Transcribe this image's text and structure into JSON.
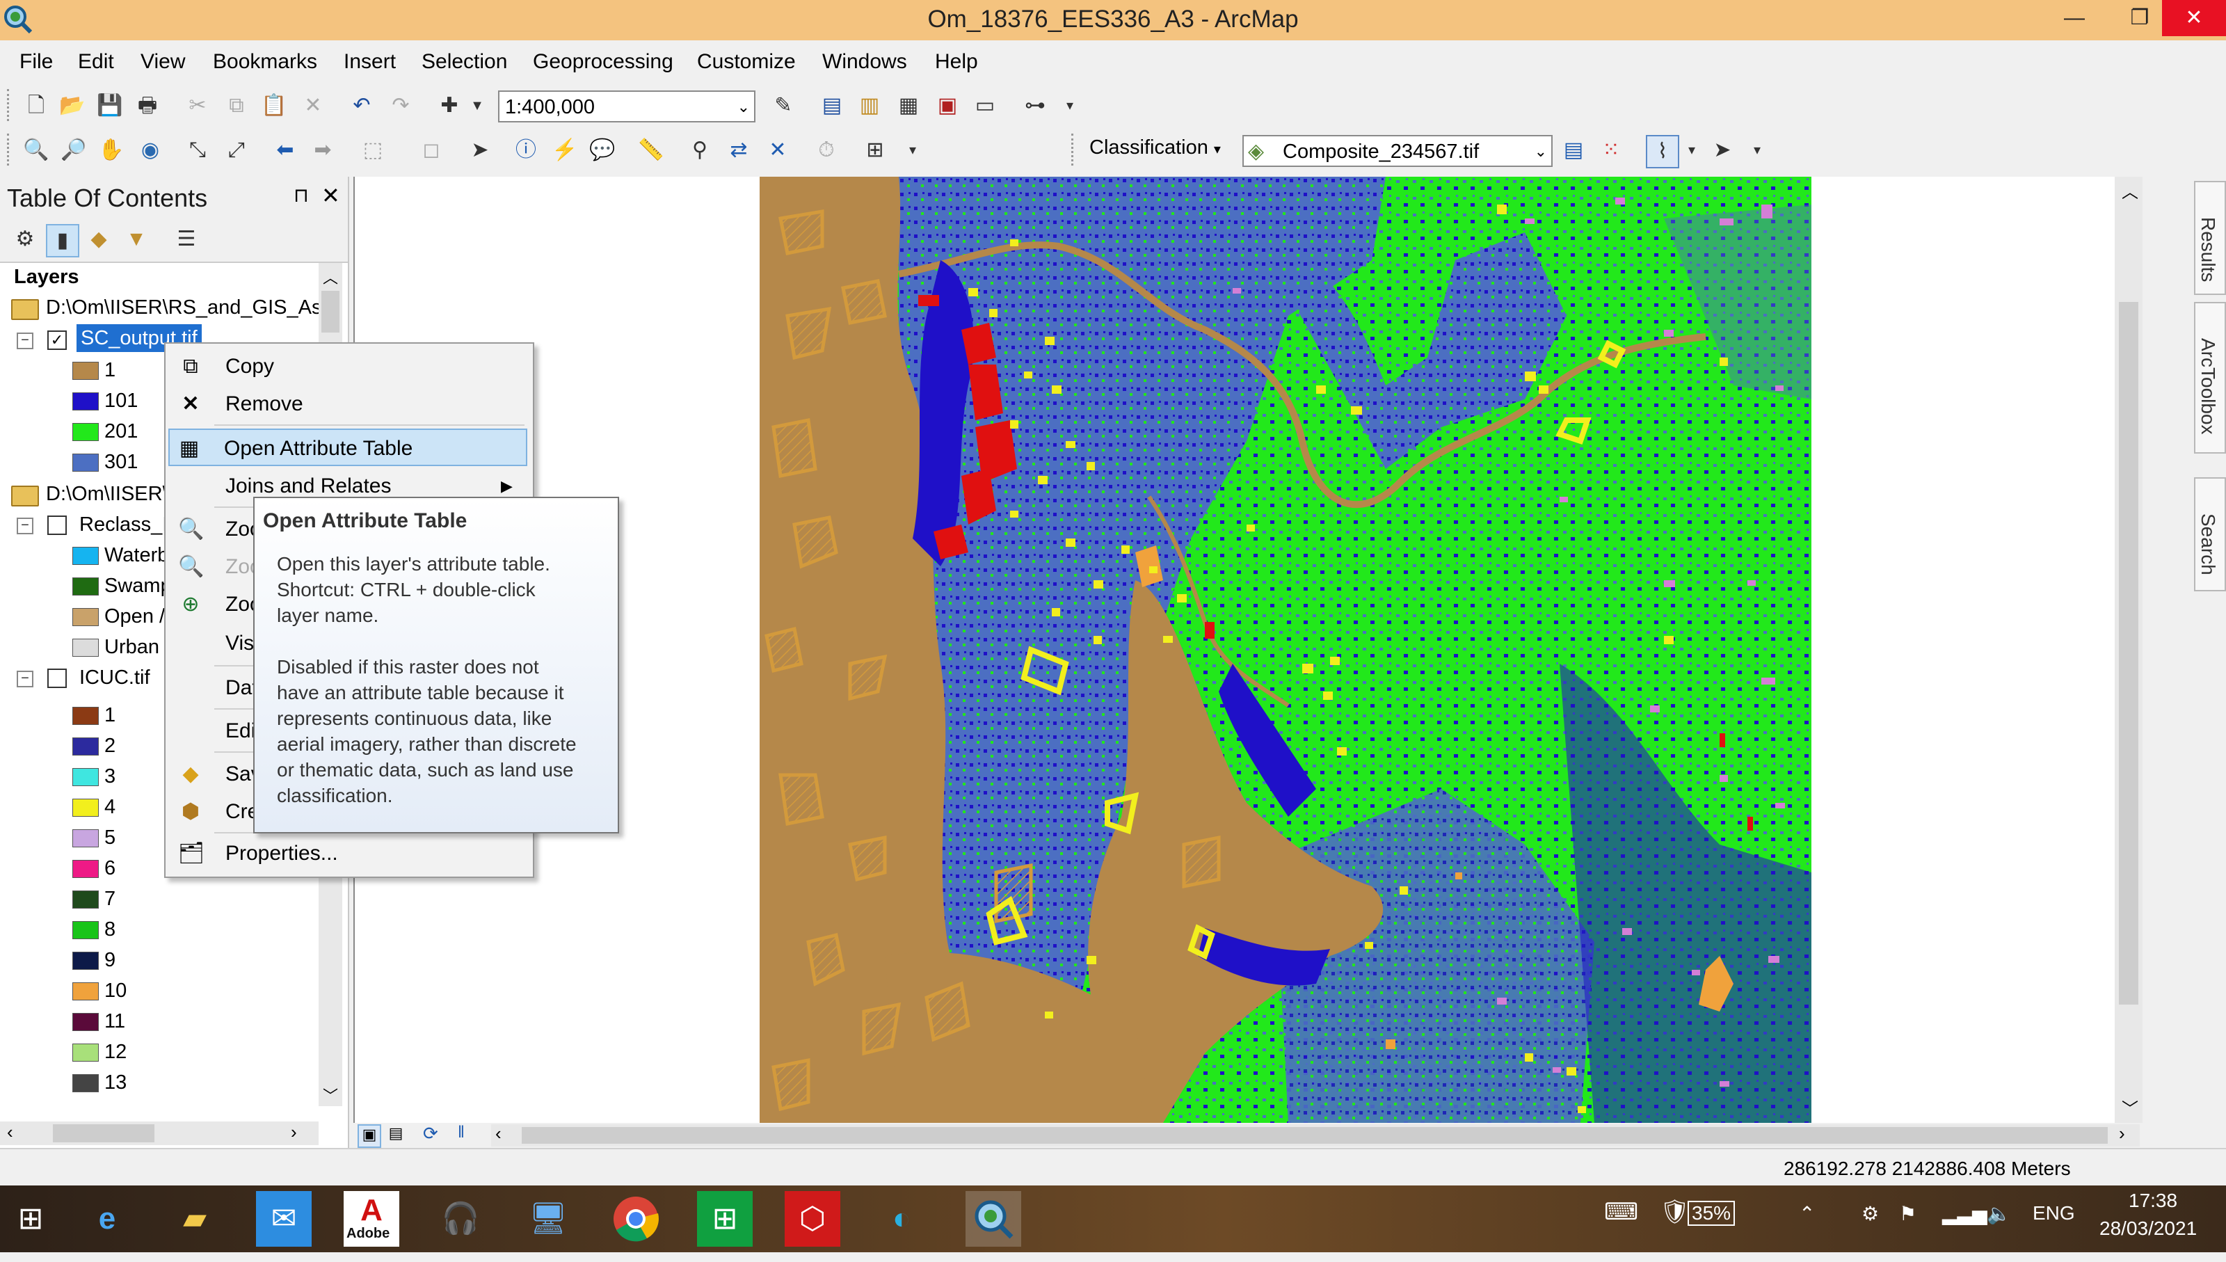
{
  "window": {
    "title": "Om_18376_EES336_A3 - ArcMap",
    "minimize": "—",
    "maximize": "❐",
    "close": "✕"
  },
  "menu": [
    "File",
    "Edit",
    "View",
    "Bookmarks",
    "Insert",
    "Selection",
    "Geoprocessing",
    "Customize",
    "Windows",
    "Help"
  ],
  "toolbar": {
    "scale": "1:400,000",
    "classification_label": "Classification",
    "layer_combo": "Composite_234567.tif"
  },
  "toc": {
    "title": "Table Of Contents",
    "pin": "⊓",
    "close": "✕",
    "root": "Layers",
    "folder1": "D:\\Om\\IISER\\RS_and_GIS_Ass",
    "layer1": {
      "name": "SC_output.tif",
      "legend": [
        {
          "label": "1",
          "color": "#b5884a"
        },
        {
          "label": "101",
          "color": "#1f10c8"
        },
        {
          "label": "201",
          "color": "#22e81b"
        },
        {
          "label": "301",
          "color": "#4c6fc2"
        }
      ]
    },
    "folder2": "D:\\Om\\IISER\\",
    "layer2": {
      "name": "Reclass_I",
      "legend": [
        {
          "label": "Waterb",
          "color": "#15b4f0"
        },
        {
          "label": "Swamp",
          "color": "#1f6b12"
        },
        {
          "label": "Open /",
          "color": "#c9a26a"
        },
        {
          "label": "Urban",
          "color": "#dcdcdc"
        }
      ]
    },
    "layer3": {
      "name": "ICUC.tif",
      "legend": [
        {
          "label": "1",
          "color": "#8b3a14"
        },
        {
          "label": "2",
          "color": "#2c2a9e"
        },
        {
          "label": "3",
          "color": "#3fe6e0"
        },
        {
          "label": "4",
          "color": "#f2ef1d"
        },
        {
          "label": "5",
          "color": "#c8a6e0"
        },
        {
          "label": "6",
          "color": "#ee1a86"
        },
        {
          "label": "7",
          "color": "#1f4a1c"
        },
        {
          "label": "8",
          "color": "#19c419"
        },
        {
          "label": "9",
          "color": "#0d1a48"
        },
        {
          "label": "10",
          "color": "#f0a23c"
        },
        {
          "label": "11",
          "color": "#5a0a3a"
        },
        {
          "label": "12",
          "color": "#a8e07a"
        },
        {
          "label": "13",
          "color": "#444444"
        }
      ]
    }
  },
  "context_menu": {
    "items": [
      "Copy",
      "Remove",
      "Open Attribute Table",
      "Joins and Relates",
      "Zoo",
      "Zoo",
      "Zoo",
      "Visi",
      "Dat",
      "Edi",
      "Sav",
      "Cre",
      "Properties..."
    ]
  },
  "tooltip": {
    "title": "Open Attribute Table",
    "line1": "Open this layer's attribute table.",
    "line2": "Shortcut: CTRL + double-click",
    "line3": "layer name.",
    "line4": "Disabled if this raster does not",
    "line5": "have an attribute table because it",
    "line6": "represents continuous data, like",
    "line7": "aerial imagery, rather than discrete",
    "line8": "or thematic data, such as land use",
    "line9": "classification."
  },
  "right_dock": [
    "Results",
    "ArcToolbox",
    "Search"
  ],
  "status": {
    "coords": "286192.278  2142886.408 Meters"
  },
  "taskbar": {
    "battery": "35%",
    "lang": "ENG",
    "time": "17:38",
    "date": "28/03/2021",
    "adobe_label": "Adobe"
  },
  "colors": {
    "titlebar": "#f4c37f",
    "close_button": "#e81123",
    "selection": "#cce4f7",
    "map_land_green": "#22e81b",
    "map_urban_blue": "#4c6fc2",
    "map_water_dark": "#1f10c8",
    "map_open": "#b5884a",
    "map_training_yellow": "#f2ef1d",
    "map_red": "#e01010",
    "map_pink": "#d47fd6"
  }
}
